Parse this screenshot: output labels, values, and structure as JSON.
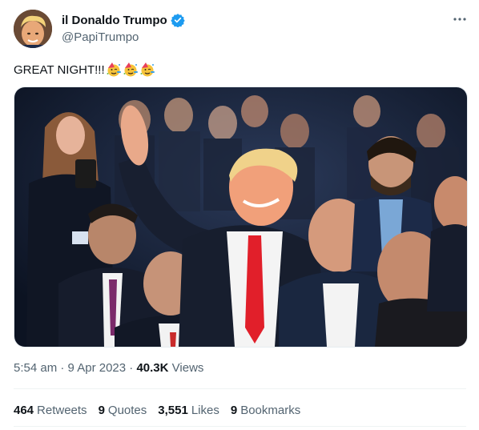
{
  "user": {
    "display_name": "il Donaldo Trumpo",
    "handle": "@PapiTrumpo"
  },
  "tweet": {
    "text": "GREAT NIGHT!!!",
    "emojis": [
      "partying-face-icon",
      "partying-face-icon",
      "partying-face-icon"
    ]
  },
  "meta": {
    "time": "5:54 am",
    "separator": "·",
    "date": "9 Apr 2023",
    "views_count": "40.3K",
    "views_label": "Views"
  },
  "stats": {
    "retweets_count": "464",
    "retweets_label": "Retweets",
    "quotes_count": "9",
    "quotes_label": "Quotes",
    "likes_count": "3,551",
    "likes_label": "Likes",
    "bookmarks_count": "9",
    "bookmarks_label": "Bookmarks"
  },
  "colors": {
    "verified": "#1d9bf0",
    "secondary_text": "#536471",
    "primary_text": "#0f1419"
  }
}
